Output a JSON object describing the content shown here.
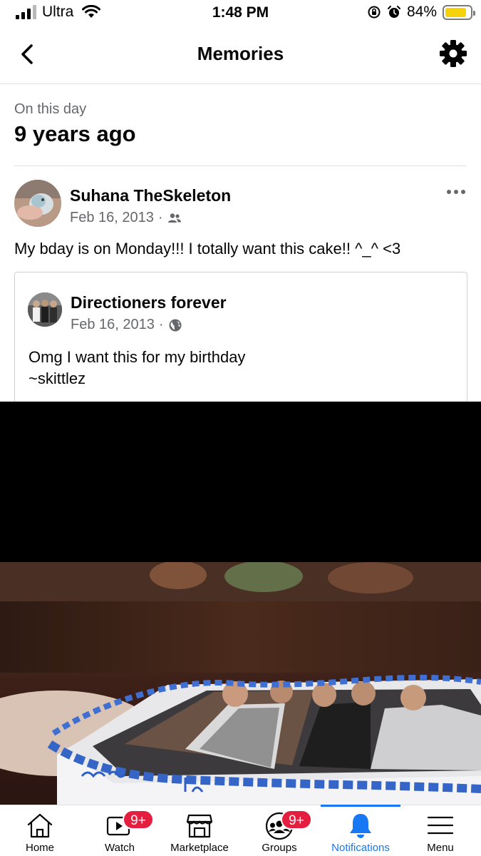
{
  "status_bar": {
    "carrier": "Ultra",
    "time": "1:48 PM",
    "battery_percent": "84%",
    "battery_level": 0.84
  },
  "header": {
    "title": "Memories",
    "back_icon": "chevron-left-icon",
    "settings_icon": "gear-icon"
  },
  "section": {
    "label": "On this day",
    "years_ago": "9 years ago"
  },
  "post": {
    "author": "Suhana TheSkeleton",
    "date": "Feb 16, 2013",
    "separator": "·",
    "audience_icon": "friends-icon",
    "text": "My bday is on Monday!!! I totally want this cake!! ^_^ <3"
  },
  "shared_post": {
    "author": "Directioners forever",
    "date": "Feb 16, 2013",
    "separator": "·",
    "audience_icon": "globe-icon",
    "text_line1": "Omg I want this for my birthday",
    "text_line2": "~skittlez"
  },
  "tabs": [
    {
      "label": "Home",
      "icon": "home-icon"
    },
    {
      "label": "Watch",
      "icon": "watch-icon",
      "badge": "9+"
    },
    {
      "label": "Marketplace",
      "icon": "marketplace-icon"
    },
    {
      "label": "Groups",
      "icon": "groups-icon",
      "badge": "9+"
    },
    {
      "label": "Notifications",
      "icon": "bell-icon",
      "active": true
    },
    {
      "label": "Menu",
      "icon": "menu-icon"
    }
  ],
  "colors": {
    "accent": "#1877f2",
    "badge": "#e41e3f",
    "secondary_text": "#65676b",
    "battery": "#f5d20a"
  }
}
